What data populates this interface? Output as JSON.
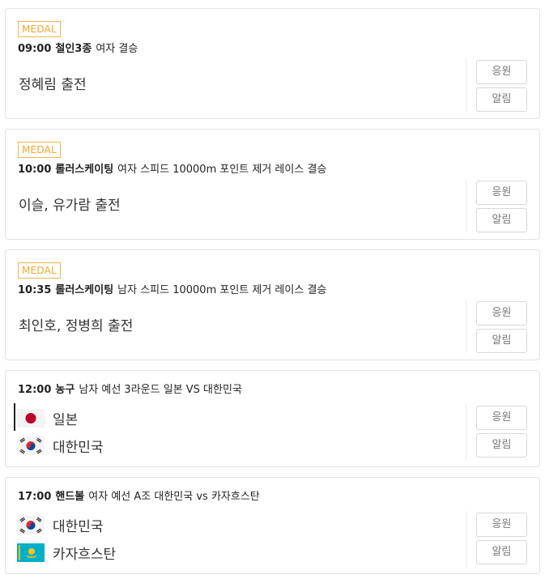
{
  "events": [
    {
      "badge": "MEDAL",
      "time": "09:00",
      "sport": "철인3종",
      "detail": "여자 결승",
      "athletes": "정혜림 출전",
      "cheer_label": "응원",
      "alert_label": "알림"
    },
    {
      "badge": "MEDAL",
      "time": "10:00",
      "sport": "롤러스케이팅",
      "detail": "여자 스피드 10000m 포인트 제거 레이스 결승",
      "athletes": "이슬, 유가람 출전",
      "cheer_label": "응원",
      "alert_label": "알림"
    },
    {
      "badge": "MEDAL",
      "time": "10:35",
      "sport": "롤러스케이팅",
      "detail": "남자 스피드 10000m 포인트 제거 레이스 결승",
      "athletes": "최인호, 정병희 출전",
      "cheer_label": "응원",
      "alert_label": "알림"
    },
    {
      "time": "12:00",
      "sport": "농구",
      "detail": "남자 예선 3라운드 일본 VS 대한민국",
      "team1": {
        "name": "일본",
        "flag": "japan-flag-icon"
      },
      "team2": {
        "name": "대한민국",
        "flag": "korea-flag-icon"
      },
      "cheer_label": "응원",
      "alert_label": "알림"
    },
    {
      "time": "17:00",
      "sport": "핸드볼",
      "detail": "여자 예선 A조 대한민국 vs 카자흐스탄",
      "team1": {
        "name": "대한민국",
        "flag": "korea-flag-icon"
      },
      "team2": {
        "name": "카자흐스탄",
        "flag": "kazakhstan-flag-icon"
      },
      "cheer_label": "응원",
      "alert_label": "알림"
    }
  ],
  "colors": {
    "medal_badge": "#f0a92c",
    "card_border": "#e3e3e3",
    "button_text": "#777777",
    "korea_red": "#cd2e3a",
    "korea_blue": "#0047a0",
    "japan_red": "#bc002d",
    "kazakhstan_blue": "#00afca",
    "kazakhstan_gold": "#fec50c"
  }
}
